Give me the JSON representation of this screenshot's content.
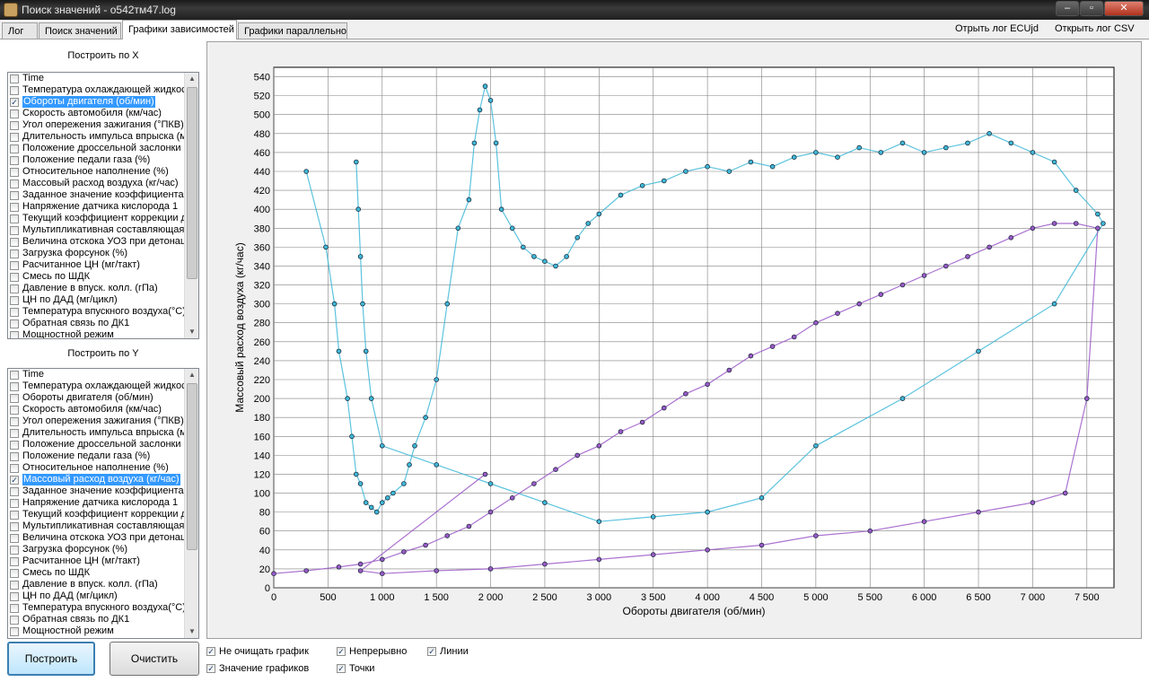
{
  "window": {
    "title": "Поиск значений - о542тм47.log",
    "min": "–",
    "max": "▫",
    "close": "✕"
  },
  "tabs": [
    "Лог",
    "Поиск значений",
    "Графики зависимостей",
    "Графики параллельно"
  ],
  "links": {
    "ecu": "Отрыть лог ECUjd",
    "csv": "Открыть лог CSV"
  },
  "panel_x": {
    "title": "Построить по X",
    "items": [
      {
        "label": "Time",
        "checked": false
      },
      {
        "label": "Температура охлаждающей жидкости",
        "checked": false
      },
      {
        "label": "Обороты  двигателя (об/мин)",
        "checked": true
      },
      {
        "label": "Скорость автомобиля (км/час)",
        "checked": false
      },
      {
        "label": "Угол опережения зажигания (°ПКВ)",
        "checked": false
      },
      {
        "label": "Длительность импульса впрыска (мс)",
        "checked": false
      },
      {
        "label": "Положение дроссельной заслонки (%)",
        "checked": false
      },
      {
        "label": "Положение педали газа (%)",
        "checked": false
      },
      {
        "label": "Относительное наполнение (%)",
        "checked": false
      },
      {
        "label": "Массовый расход воздуха (кг/час)",
        "checked": false
      },
      {
        "label": "Заданное значение коэффициента",
        "checked": false
      },
      {
        "label": "Напряжение датчика кислорода 1",
        "checked": false
      },
      {
        "label": "Текущий коэффициент коррекции д",
        "checked": false
      },
      {
        "label": "Мультипликативная составляющая",
        "checked": false
      },
      {
        "label": "Величина отскока УОЗ при детонации",
        "checked": false
      },
      {
        "label": "Загрузка форсунок (%)",
        "checked": false
      },
      {
        "label": "Расчитанное ЦН (мг/такт)",
        "checked": false
      },
      {
        "label": "Смесь по ШДК",
        "checked": false
      },
      {
        "label": "Давление в впуск. колл. (гПа)",
        "checked": false
      },
      {
        "label": "ЦН по ДАД (мг/цикл)",
        "checked": false
      },
      {
        "label": "Температура впускного воздуха(°С)",
        "checked": false
      },
      {
        "label": "Обратная связь по ДК1",
        "checked": false
      },
      {
        "label": "Мощностной режим",
        "checked": false
      }
    ]
  },
  "panel_y": {
    "title": "Построить по Y",
    "items": [
      {
        "label": "Time",
        "checked": false
      },
      {
        "label": "Температура охлаждающей жидкости",
        "checked": false
      },
      {
        "label": "Обороты  двигателя (об/мин)",
        "checked": false
      },
      {
        "label": "Скорость автомобиля (км/час)",
        "checked": false
      },
      {
        "label": "Угол опережения зажигания (°ПКВ)",
        "checked": false
      },
      {
        "label": "Длительность импульса впрыска (мс)",
        "checked": false
      },
      {
        "label": "Положение дроссельной заслонки (%)",
        "checked": false
      },
      {
        "label": "Положение педали газа (%)",
        "checked": false
      },
      {
        "label": "Относительное наполнение (%)",
        "checked": false
      },
      {
        "label": "Массовый расход воздуха (кг/час)",
        "checked": true
      },
      {
        "label": "Заданное значение коэффициента",
        "checked": false
      },
      {
        "label": "Напряжение датчика кислорода 1",
        "checked": false
      },
      {
        "label": "Текущий коэффициент коррекции д",
        "checked": false
      },
      {
        "label": "Мультипликативная составляющая",
        "checked": false
      },
      {
        "label": "Величина отскока УОЗ при детонации",
        "checked": false
      },
      {
        "label": "Загрузка форсунок (%)",
        "checked": false
      },
      {
        "label": "Расчитанное ЦН (мг/такт)",
        "checked": false
      },
      {
        "label": "Смесь по ШДК",
        "checked": false
      },
      {
        "label": "Давление в впуск. колл. (гПа)",
        "checked": false
      },
      {
        "label": "ЦН по ДАД (мг/цикл)",
        "checked": false
      },
      {
        "label": "Температура впускного воздуха(°С)",
        "checked": false
      },
      {
        "label": "Обратная связь по ДК1",
        "checked": false
      },
      {
        "label": "Мощностной режим",
        "checked": false
      }
    ]
  },
  "buttons": {
    "build": "Построить",
    "clear": "Очистить"
  },
  "options": [
    {
      "label": "Не очищать график",
      "checked": true
    },
    {
      "label": "Значение графиков",
      "checked": true
    },
    {
      "label": "Непрерывно",
      "checked": true
    },
    {
      "label": "Точки",
      "checked": true
    },
    {
      "label": "Линии",
      "checked": true
    }
  ],
  "colors": {
    "series_a": "#3fb8d8",
    "series_b": "#9b59c8",
    "plot_bg": "#ffffff",
    "grid": "#808080"
  },
  "chart_data": {
    "type": "scatter",
    "xlabel": "Обороты двигателя (об/мин)",
    "ylabel": "Массовый расход воздуха (кг/час)",
    "xlim": [
      0,
      7750
    ],
    "ylim": [
      0,
      550
    ],
    "x_ticks": [
      0,
      500,
      1000,
      1500,
      2000,
      2500,
      3000,
      3500,
      4000,
      4500,
      5000,
      5500,
      6000,
      6500,
      7000,
      7500
    ],
    "x_tick_labels": [
      "0",
      "500",
      "1 000",
      "1 500",
      "2 000",
      "2 500",
      "3 000",
      "3 500",
      "4 000",
      "4 500",
      "5 000",
      "5 500",
      "6 000",
      "6 500",
      "7 000",
      "7 500"
    ],
    "y_ticks": [
      0,
      20,
      40,
      60,
      80,
      100,
      120,
      140,
      160,
      180,
      200,
      220,
      240,
      260,
      280,
      300,
      320,
      340,
      360,
      380,
      400,
      420,
      440,
      460,
      480,
      500,
      520,
      540
    ],
    "grid": true,
    "series": [
      {
        "color": "#3fb8d8",
        "points": [
          [
            300,
            440
          ],
          [
            480,
            360
          ],
          [
            560,
            300
          ],
          [
            600,
            250
          ],
          [
            680,
            200
          ],
          [
            720,
            160
          ],
          [
            760,
            120
          ],
          [
            800,
            110
          ],
          [
            850,
            90
          ],
          [
            900,
            85
          ],
          [
            950,
            80
          ],
          [
            1000,
            90
          ],
          [
            1050,
            95
          ],
          [
            1100,
            100
          ],
          [
            1200,
            110
          ],
          [
            1250,
            130
          ],
          [
            1300,
            150
          ],
          [
            1400,
            180
          ],
          [
            1500,
            220
          ],
          [
            1600,
            300
          ],
          [
            1700,
            380
          ],
          [
            1800,
            410
          ],
          [
            1850,
            470
          ],
          [
            1900,
            505
          ],
          [
            1950,
            530
          ],
          [
            2000,
            515
          ],
          [
            2050,
            470
          ],
          [
            2100,
            400
          ],
          [
            2200,
            380
          ],
          [
            2300,
            360
          ],
          [
            2400,
            350
          ],
          [
            2500,
            345
          ],
          [
            2600,
            340
          ],
          [
            2700,
            350
          ],
          [
            2800,
            370
          ],
          [
            2900,
            385
          ],
          [
            3000,
            395
          ],
          [
            3200,
            415
          ],
          [
            3400,
            425
          ],
          [
            3600,
            430
          ],
          [
            3800,
            440
          ],
          [
            4000,
            445
          ],
          [
            4200,
            440
          ],
          [
            4400,
            450
          ],
          [
            4600,
            445
          ],
          [
            4800,
            455
          ],
          [
            5000,
            460
          ],
          [
            5200,
            455
          ],
          [
            5400,
            465
          ],
          [
            5600,
            460
          ],
          [
            5800,
            470
          ],
          [
            6000,
            460
          ],
          [
            6200,
            465
          ],
          [
            6400,
            470
          ],
          [
            6600,
            480
          ],
          [
            6800,
            470
          ],
          [
            7000,
            460
          ],
          [
            7200,
            450
          ],
          [
            7400,
            420
          ],
          [
            7600,
            395
          ],
          [
            7650,
            385
          ],
          [
            7200,
            300
          ],
          [
            6500,
            250
          ],
          [
            5800,
            200
          ],
          [
            5000,
            150
          ],
          [
            4500,
            95
          ],
          [
            4000,
            80
          ],
          [
            3500,
            75
          ],
          [
            3000,
            70
          ],
          [
            2500,
            90
          ],
          [
            2000,
            110
          ],
          [
            1500,
            130
          ],
          [
            1000,
            150
          ],
          [
            900,
            200
          ],
          [
            850,
            250
          ],
          [
            820,
            300
          ],
          [
            800,
            350
          ],
          [
            780,
            400
          ],
          [
            760,
            450
          ]
        ]
      },
      {
        "color": "#9b59c8",
        "points": [
          [
            0,
            15
          ],
          [
            300,
            18
          ],
          [
            600,
            22
          ],
          [
            800,
            25
          ],
          [
            1000,
            30
          ],
          [
            1200,
            38
          ],
          [
            1400,
            45
          ],
          [
            1600,
            55
          ],
          [
            1800,
            65
          ],
          [
            2000,
            80
          ],
          [
            2200,
            95
          ],
          [
            2400,
            110
          ],
          [
            2600,
            125
          ],
          [
            2800,
            140
          ],
          [
            3000,
            150
          ],
          [
            3200,
            165
          ],
          [
            3400,
            175
          ],
          [
            3600,
            190
          ],
          [
            3800,
            205
          ],
          [
            4000,
            215
          ],
          [
            4200,
            230
          ],
          [
            4400,
            245
          ],
          [
            4600,
            255
          ],
          [
            4800,
            265
          ],
          [
            5000,
            280
          ],
          [
            5200,
            290
          ],
          [
            5400,
            300
          ],
          [
            5600,
            310
          ],
          [
            5800,
            320
          ],
          [
            6000,
            330
          ],
          [
            6200,
            340
          ],
          [
            6400,
            350
          ],
          [
            6600,
            360
          ],
          [
            6800,
            370
          ],
          [
            7000,
            380
          ],
          [
            7200,
            385
          ],
          [
            7400,
            385
          ],
          [
            7600,
            380
          ],
          [
            7500,
            200
          ],
          [
            7300,
            100
          ],
          [
            7000,
            90
          ],
          [
            6500,
            80
          ],
          [
            6000,
            70
          ],
          [
            5500,
            60
          ],
          [
            5000,
            55
          ],
          [
            4500,
            45
          ],
          [
            4000,
            40
          ],
          [
            3500,
            35
          ],
          [
            3000,
            30
          ],
          [
            2500,
            25
          ],
          [
            2000,
            20
          ],
          [
            1500,
            18
          ],
          [
            1000,
            15
          ],
          [
            800,
            18
          ],
          [
            1950,
            120
          ]
        ]
      }
    ]
  }
}
